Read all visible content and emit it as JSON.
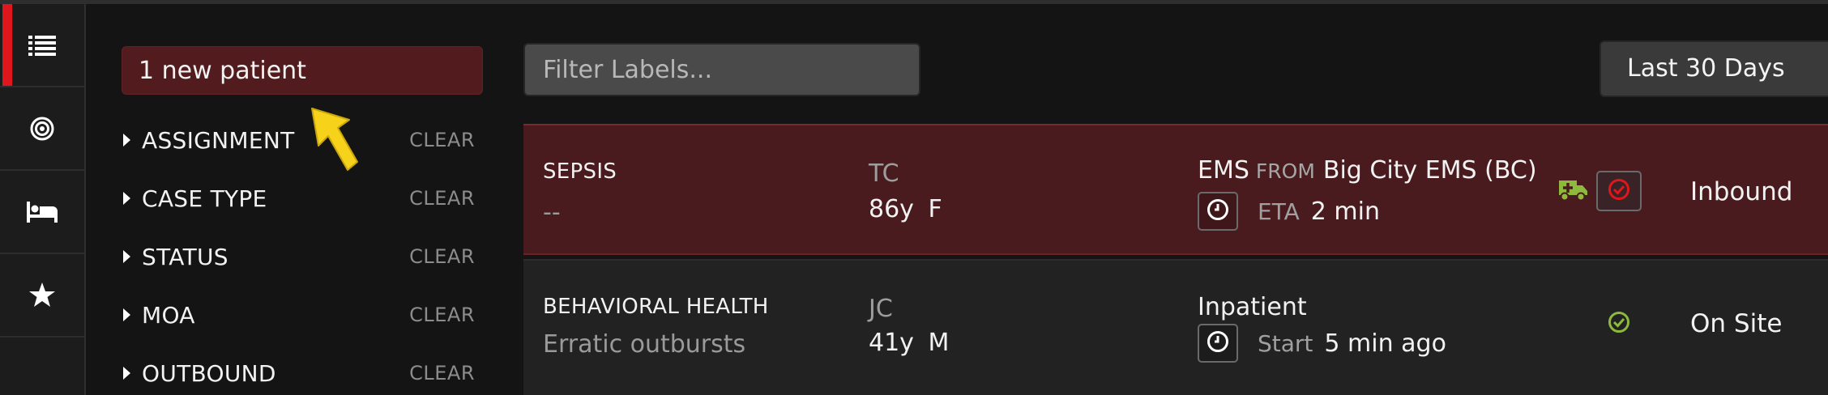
{
  "colors": {
    "accent_red": "#e0161d",
    "alert_row_bg": "#4a1b1e",
    "new_patient_bg": "#521c1e",
    "ambulance_green": "#8db93c",
    "check_green": "#8db93c",
    "pointer_yellow": "#f7d21b"
  },
  "sidebar": {
    "items": [
      {
        "icon": "list-icon",
        "active": true
      },
      {
        "icon": "target-icon",
        "active": false
      },
      {
        "icon": "bed-icon",
        "active": false
      },
      {
        "icon": "star-icon",
        "active": false
      }
    ]
  },
  "filters": {
    "new_patient_label": "1 new patient",
    "groups": [
      {
        "label": "ASSIGNMENT",
        "clear": "CLEAR"
      },
      {
        "label": "CASE TYPE",
        "clear": "CLEAR"
      },
      {
        "label": "STATUS",
        "clear": "CLEAR"
      },
      {
        "label": "MOA",
        "clear": "CLEAR"
      },
      {
        "label": "OUTBOUND",
        "clear": "CLEAR"
      }
    ]
  },
  "toolbar": {
    "filter_placeholder": "Filter Labels...",
    "date_range": "Last 30 Days"
  },
  "patients": [
    {
      "case_type": "SEPSIS",
      "complaint": "--",
      "initials": "TC",
      "age": "86y",
      "sex": "F",
      "source": "EMS",
      "from_label": "FROM",
      "from_value": "Big City EMS (BC)",
      "time_label": "ETA",
      "time_value": "2 min",
      "status": "Inbound"
    },
    {
      "case_type": "BEHAVIORAL HEALTH",
      "complaint": "Erratic outbursts",
      "initials": "JC",
      "age": "41y",
      "sex": "M",
      "source": "Inpatient",
      "time_label": "Start",
      "time_value": "5 min ago",
      "status": "On Site"
    }
  ]
}
